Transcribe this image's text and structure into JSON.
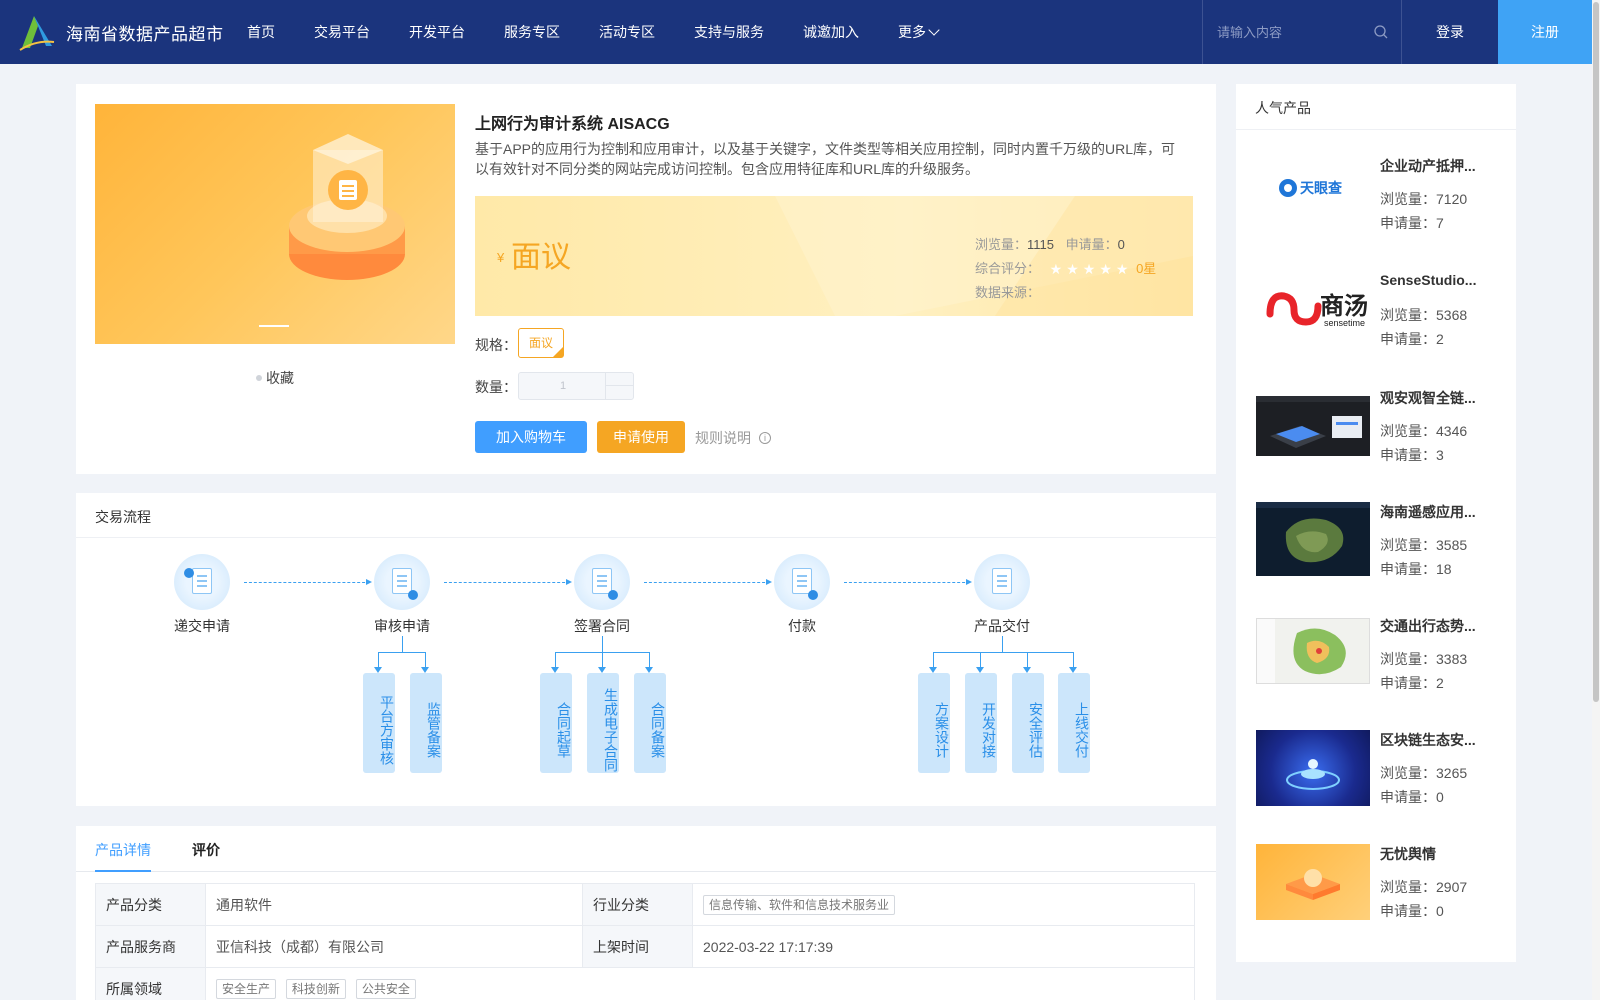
{
  "header": {
    "site_title": "海南省数据产品超市",
    "nav": [
      "首页",
      "交易平台",
      "开发平台",
      "服务专区",
      "活动专区",
      "支持与服务",
      "诚邀加入",
      "更多"
    ],
    "search_placeholder": "请输入内容",
    "login": "登录",
    "register": "注册"
  },
  "product": {
    "title": "上网行为审计系统 AISACG",
    "description": "基于APP的应用行为控制和应用审计，以及基于关键字，文件类型等相关应用控制，同时内置千万级的URL库，可以有效针对不同分类的网站完成访问控制。包含应用特征库和URL库的升级服务。",
    "currency_symbol": "¥",
    "price": "面议",
    "views_label": "浏览量：",
    "views": "1115",
    "applies_label": "申请量：",
    "applies": "0",
    "rating_label": "综合评分：",
    "rating_score": "0星",
    "rating_stars": 0,
    "source_label": "数据来源：",
    "spec_label": "规格：",
    "spec_value": "面议",
    "qty_label": "数量：",
    "qty_value": "1",
    "favorite": "收藏",
    "add_cart": "加入购物车",
    "apply": "申请使用",
    "rules": "规则说明"
  },
  "flow": {
    "title": "交易流程",
    "steps": [
      "递交申请",
      "审核申请",
      "签署合同",
      "付款",
      "产品交付"
    ],
    "substeps": {
      "review": [
        "平台方审核",
        "监管备案"
      ],
      "contract": [
        "合同起草",
        "生成电子合同",
        "合同备案"
      ],
      "delivery": [
        "方案设计",
        "开发对接",
        "安全评估",
        "上线交付"
      ]
    }
  },
  "detail": {
    "tabs": [
      "产品详情",
      "评价"
    ],
    "rows": {
      "category_label": "产品分类",
      "category": "通用软件",
      "industry_label": "行业分类",
      "industry": "信息传输、软件和信息技术服务业",
      "provider_label": "产品服务商",
      "provider": "亚信科技（成都）有限公司",
      "listed_label": "上架时间",
      "listed": "2022-03-22 17:17:39",
      "domain_label": "所属领域",
      "domains": [
        "安全生产",
        "科技创新",
        "公共安全"
      ]
    }
  },
  "popular": {
    "title": "人气产品",
    "views_label": "浏览量：",
    "applies_label": "申请量：",
    "items": [
      {
        "name": "企业动产抵押...",
        "views": "7120",
        "applies": "7",
        "logo_text": "天眼查"
      },
      {
        "name": "SenseStudio...",
        "views": "5368",
        "applies": "2",
        "logo_text": "商汤",
        "logo_sub": "sensetime"
      },
      {
        "name": "观安观智全链...",
        "views": "4346",
        "applies": "3"
      },
      {
        "name": "海南遥感应用...",
        "views": "3585",
        "applies": "18"
      },
      {
        "name": "交通出行态势...",
        "views": "3383",
        "applies": "2"
      },
      {
        "name": "区块链生态安...",
        "views": "3265",
        "applies": "0"
      },
      {
        "name": "无忧舆情",
        "views": "2907",
        "applies": "0"
      }
    ]
  },
  "colors": {
    "header_bg": "#1b347d",
    "register_bg": "#3fa3f5",
    "primary": "#409eff",
    "accent_orange": "#f5a623",
    "flow_blue": "#3aa0f0"
  }
}
